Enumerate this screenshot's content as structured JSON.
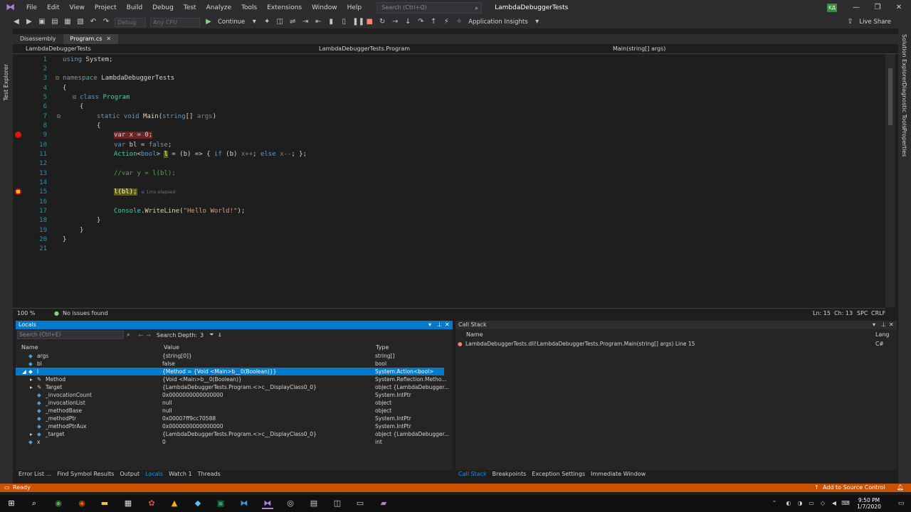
{
  "titlebar": {
    "menu": [
      "File",
      "Edit",
      "View",
      "Project",
      "Build",
      "Debug",
      "Test",
      "Analyze",
      "Tools",
      "Extensions",
      "Window",
      "Help"
    ],
    "search_placeholder": "Search (Ctrl+Q)",
    "solution_title": "LambdaDebuggerTests",
    "avatar": "KД"
  },
  "toolbar": {
    "config": "Debug",
    "platform": "Any CPU",
    "continue_label": "Continue",
    "app_insights": "Application Insights",
    "live_share": "Live Share"
  },
  "left_strip": {
    "label": "Test Explorer"
  },
  "right_strip": {
    "tabs": [
      "Solution Explorer",
      "Diagnostic Tools",
      "Properties"
    ]
  },
  "doc_tabs": [
    "Disassembly",
    "Program.cs"
  ],
  "navbar": {
    "project": "LambdaDebuggerTests",
    "class": "LambdaDebuggerTests.Program",
    "member": "Main(string[] args)"
  },
  "code": {
    "line_numbers": [
      "1",
      "2",
      "3",
      "4",
      "5",
      "6",
      "7",
      "8",
      "9",
      "10",
      "11",
      "12",
      "13",
      "14",
      "15",
      "16",
      "17",
      "18",
      "19",
      "20",
      "21"
    ],
    "l1_kw": "using",
    "l1_rest": " System;",
    "l3_kw": "namespace",
    "l3_rest": " LambdaDebuggerTests",
    "brace_open": "{",
    "brace_close": "}",
    "l5_kw": "class",
    "l5_ty": " Program",
    "l7_kw": "static void",
    "l7_fn": " Main",
    "l7_p1": "(",
    "l7_kw2": "string",
    "l7_p2": "[] ",
    "l7_arg": "args",
    "l7_p3": ")",
    "l9": "var x = 0;",
    "l10_kw": "var",
    "l10_mid": " bl = ",
    "l10_kw2": "false",
    "l10_end": ";",
    "l11_ty": "Action",
    "l11_p1": "<",
    "l11_kw": "bool",
    "l11_p2": "> ",
    "l11_var": "l",
    "l11_p3": " = (b) => { ",
    "l11_kw2": "if",
    "l11_p4": " (b) ",
    "l11_x1": "x++",
    "l11_p5": "; ",
    "l11_kw3": "else",
    "l11_p6": " ",
    "l11_x2": "x--",
    "l11_p7": "; };",
    "l13": "//var y = l(bl);",
    "l15_code": "l(bl);",
    "l15_elapsed": "≤ 1ms elapsed",
    "l17_ty": "Console",
    "l17_p1": ".",
    "l17_fn": "WriteLine",
    "l17_p2": "(",
    "l17_str": "\"Hello World!\"",
    "l17_p3": ");"
  },
  "editor_status": {
    "zoom": "100 %",
    "issues": "No issues found",
    "ln": "Ln: 15",
    "ch": "Ch: 13",
    "spc": "SPC",
    "crlf": "CRLF"
  },
  "locals": {
    "title": "Locals",
    "search_placeholder": "Search (Ctrl+E)",
    "search_depth_label": "Search Depth:",
    "search_depth": "3",
    "columns": [
      "Name",
      "Value",
      "Type"
    ],
    "rows": [
      {
        "name": "args",
        "value": "{string[0]}",
        "type": "string[]"
      },
      {
        "name": "bl",
        "value": "false",
        "type": "bool"
      },
      {
        "name": "l",
        "value": "{Method = {Void <Main>b__0(Boolean)}}",
        "type": "System.Action<bool>"
      },
      {
        "name": "Method",
        "value": "{Void <Main>b__0(Boolean)}",
        "type": "System.Reflection.Metho..."
      },
      {
        "name": "Target",
        "value": "{LambdaDebuggerTests.Program.<>c__DisplayClass0_0}",
        "type": "object {LambdaDebugger..."
      },
      {
        "name": "_invocationCount",
        "value": "0x0000000000000000",
        "type": "System.IntPtr"
      },
      {
        "name": "_invocationList",
        "value": "null",
        "type": "object"
      },
      {
        "name": "_methodBase",
        "value": "null",
        "type": "object"
      },
      {
        "name": "_methodPtr",
        "value": "0x00007ff9cc70588",
        "type": "System.IntPtr"
      },
      {
        "name": "_methodPtrAux",
        "value": "0x0000000000000000",
        "type": "System.IntPtr"
      },
      {
        "name": "_target",
        "value": "{LambdaDebuggerTests.Program.<>c__DisplayClass0_0}",
        "type": "object {LambdaDebugger..."
      },
      {
        "name": "x",
        "value": "0",
        "type": "int"
      }
    ]
  },
  "callstack": {
    "title": "Call Stack",
    "columns": [
      "Name",
      "Lang"
    ],
    "frame": "LambdaDebuggerTests.dll!LambdaDebuggerTests.Program.Main(string[] args) Line 15",
    "frame_lang": "C#"
  },
  "bottom_tabs_left": [
    "Error List ...",
    "Find Symbol Results",
    "Output",
    "Locals",
    "Watch 1",
    "Threads"
  ],
  "bottom_tabs_right": [
    "Call Stack",
    "Breakpoints",
    "Exception Settings",
    "Immediate Window"
  ],
  "statusbar": {
    "state": "Ready",
    "source_control": "Add to Source Control"
  },
  "taskbar": {
    "time": "9:50 PM",
    "date": "1/7/2020"
  },
  "colors": {
    "accent": "#007acc",
    "status_debug": "#ca5100",
    "breakpoint": "#e51400"
  }
}
